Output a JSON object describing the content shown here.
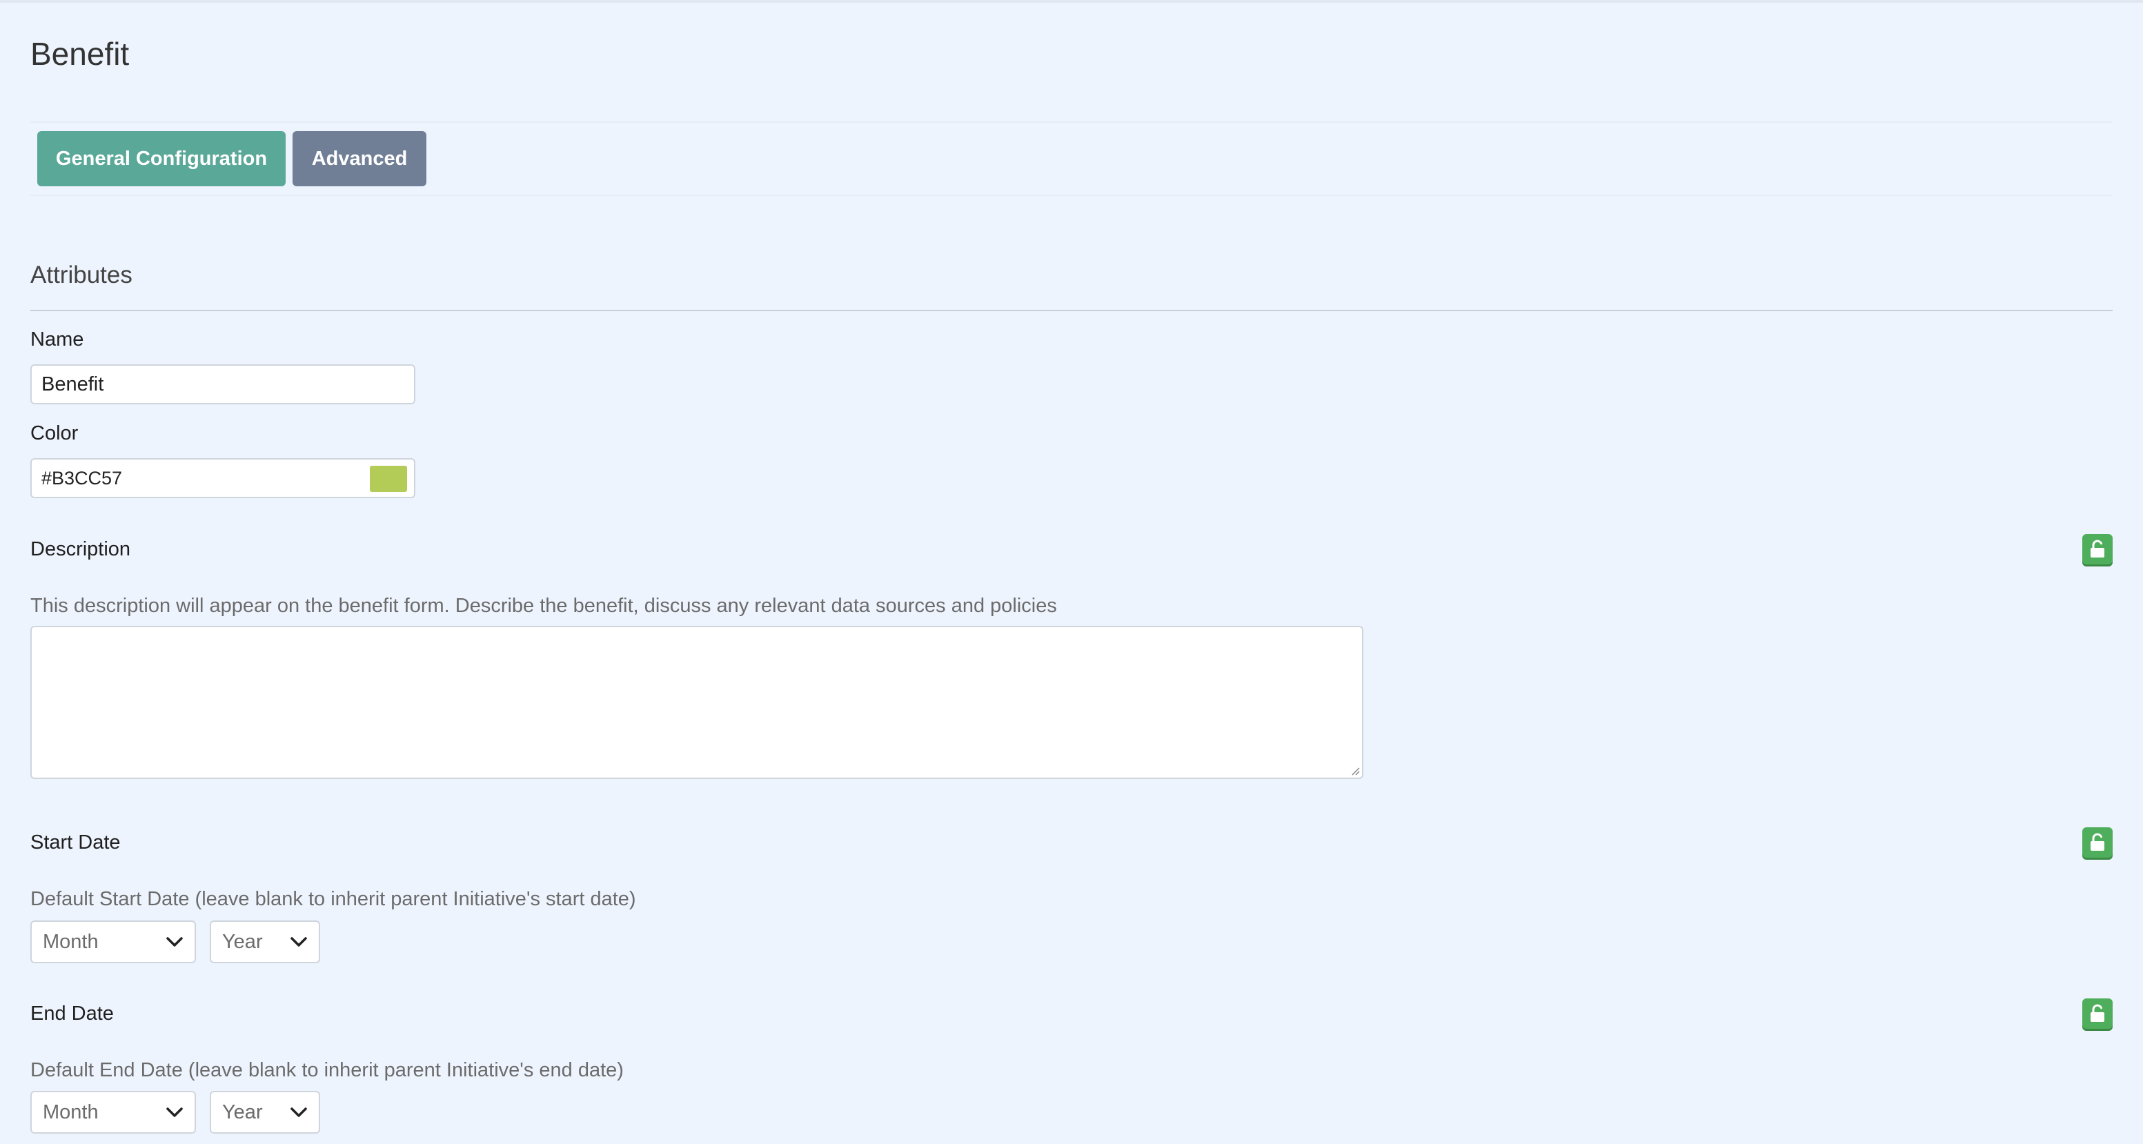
{
  "page": {
    "title": "Benefit"
  },
  "tabs": [
    {
      "label": "General Configuration",
      "active": true,
      "color": "#5aa898"
    },
    {
      "label": "Advanced",
      "active": false,
      "color": "#717f96"
    }
  ],
  "attributes": {
    "section_title": "Attributes",
    "name": {
      "label": "Name",
      "value": "Benefit"
    },
    "color": {
      "label": "Color",
      "value": "#B3CC57",
      "swatch": "#B3CC57"
    },
    "description": {
      "label": "Description",
      "help": "This description will appear on the benefit form. Describe the benefit, discuss any relevant data sources and policies",
      "value": "",
      "lock_icon": "unlock-icon"
    },
    "start_date": {
      "label": "Start Date",
      "help": "Default Start Date (leave blank to inherit parent Initiative's start date)",
      "month_placeholder": "Month",
      "year_placeholder": "Year",
      "lock_icon": "unlock-icon"
    },
    "end_date": {
      "label": "End Date",
      "help": "Default End Date (leave blank to inherit parent Initiative's end date)",
      "month_placeholder": "Month",
      "year_placeholder": "Year",
      "lock_icon": "unlock-icon"
    }
  },
  "colors": {
    "lock_green": "#4fae5c",
    "background": "#eef4fe"
  }
}
